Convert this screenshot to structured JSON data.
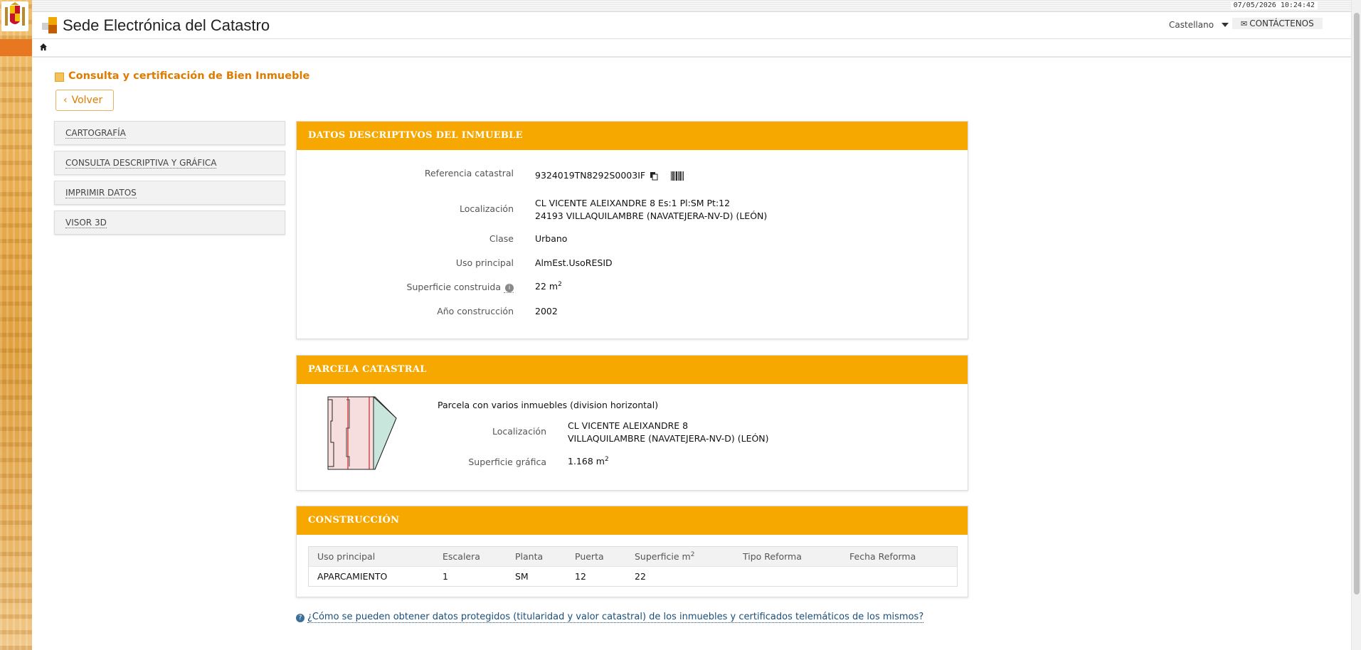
{
  "datetime": "07/05/2026  10:24:42",
  "header": {
    "site_title": "Sede Electrónica del Catastro",
    "language": "Castellano",
    "contact_label": "CONTÁCTENOS"
  },
  "page": {
    "title": "Consulta y certificación de Bien Inmueble",
    "back_label": "Volver"
  },
  "side_menu": [
    {
      "label": "CARTOGRAFÍA"
    },
    {
      "label": "CONSULTA DESCRIPTIVA Y GRÁFICA"
    },
    {
      "label": "IMPRIMIR DATOS"
    },
    {
      "label": "VISOR 3D"
    }
  ],
  "datos": {
    "heading": "DATOS DESCRIPTIVOS DEL INMUEBLE",
    "ref_label": "Referencia catastral",
    "ref_value": "9324019TN8292S0003IF",
    "loc_label": "Localización",
    "loc_line1": "CL VICENTE ALEIXANDRE 8 Es:1 Pl:SM Pt:12",
    "loc_line2": "24193 VILLAQUILAMBRE (NAVATEJERA-NV-D) (LEÓN)",
    "clase_label": "Clase",
    "clase_value": "Urbano",
    "uso_label": "Uso principal",
    "uso_value": "AlmEst.UsoRESID",
    "sup_label": "Superficie construida",
    "sup_value": "22 m",
    "sup_unit_exp": "2",
    "anio_label": "Año construcción",
    "anio_value": "2002"
  },
  "parcela": {
    "heading": "PARCELA CATASTRAL",
    "description": "Parcela con varios inmuebles (division horizontal)",
    "loc_label": "Localización",
    "loc_line1": "CL VICENTE ALEIXANDRE 8",
    "loc_line2": "VILLAQUILAMBRE (NAVATEJERA-NV-D) (LEÓN)",
    "sup_label": "Superficie gráfica",
    "sup_value": "1.168 m",
    "sup_unit_exp": "2"
  },
  "construccion": {
    "heading": "CONSTRUCCIÓN",
    "columns": [
      "Uso principal",
      "Escalera",
      "Planta",
      "Puerta",
      "Superficie m",
      "Tipo Reforma",
      "Fecha Reforma"
    ],
    "sup_col_exp": "2",
    "rows": [
      [
        "APARCAMIENTO",
        "1",
        "SM",
        "12",
        "22",
        "",
        ""
      ]
    ]
  },
  "faq_link": "¿Cómo se pueden obtener datos protegidos (titularidad y valor catastral) de los inmuebles y certificados telemáticos de los mismos?",
  "colors": {
    "accent_orange": "#f7a800",
    "title_orange": "#e07b00",
    "link_blue": "#1a4f7a"
  }
}
